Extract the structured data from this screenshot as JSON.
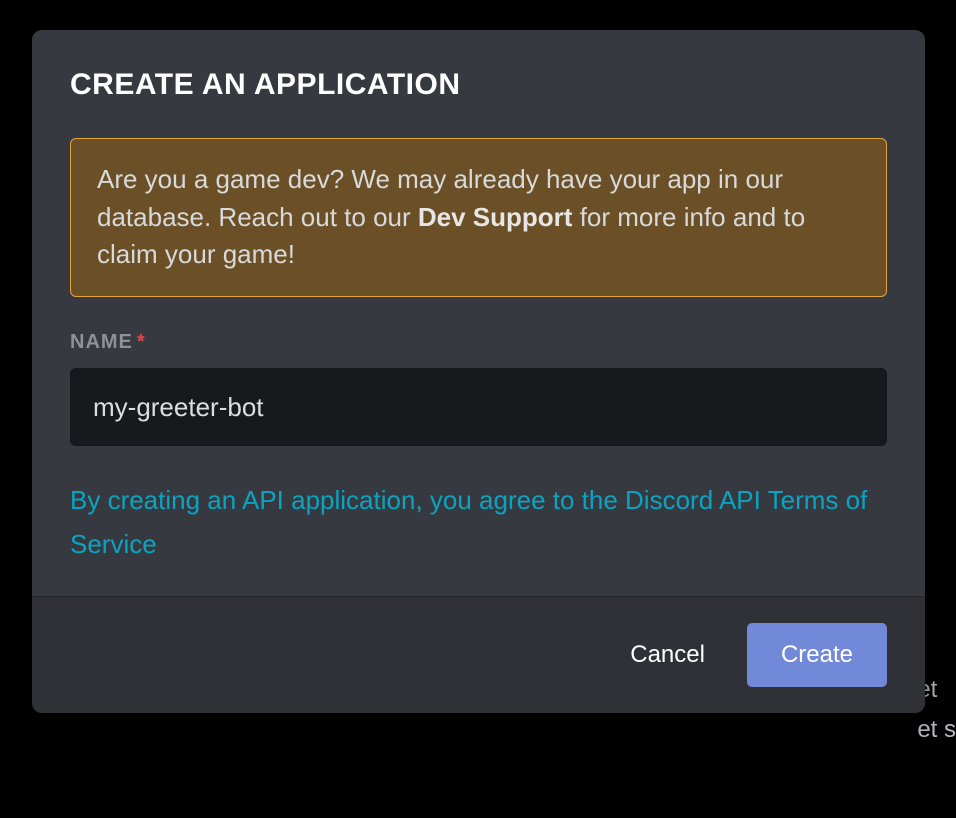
{
  "modal": {
    "title": "CREATE AN APPLICATION",
    "notice": {
      "prefix": "Are you a game dev? We may already have your app in our database. Reach out to our ",
      "strong": "Dev Support",
      "suffix": " for more info and to claim your game!"
    },
    "name_field": {
      "label": "NAME",
      "required_mark": "*",
      "value": "my-greeter-bot"
    },
    "tos_text": "By creating an API application, you agree to the Discord API Terms of Service",
    "footer": {
      "cancel_label": "Cancel",
      "create_label": "Create"
    }
  },
  "background": {
    "line1": "et",
    "line2": "et s"
  }
}
